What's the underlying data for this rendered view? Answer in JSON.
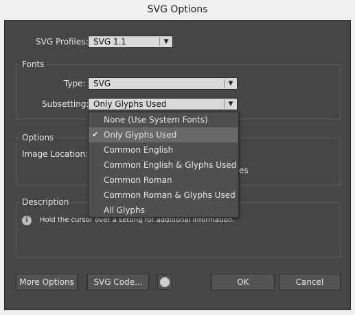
{
  "window": {
    "title": "SVG Options"
  },
  "profiles": {
    "label": "SVG Profiles:",
    "value": "SVG 1.1"
  },
  "fonts": {
    "group_title": "Fonts",
    "type_label": "Type:",
    "type_value": "SVG",
    "subsetting_label": "Subsetting:",
    "subsetting_value": "Only Glyphs Used"
  },
  "options": {
    "group_title": "Options",
    "image_location_label": "Image Location:",
    "partial_text": "es"
  },
  "subsetting_dropdown": {
    "items": [
      {
        "label": "None (Use System Fonts)"
      },
      {
        "label": "Only Glyphs Used",
        "selected": true
      },
      {
        "label": "Common English"
      },
      {
        "label": "Common English & Glyphs Used"
      },
      {
        "label": "Common Roman"
      },
      {
        "label": "Common Roman & Glyphs Used"
      },
      {
        "label": "All Glyphs"
      }
    ]
  },
  "description": {
    "group_title": "Description",
    "text": "Hold the cursor over a setting for additional information."
  },
  "buttons": {
    "more_options": "More Options",
    "svg_code": "SVG Code...",
    "ok": "OK",
    "cancel": "Cancel"
  },
  "icons": {
    "info": "info-icon",
    "globe": "globe-icon",
    "check": "checkmark-icon",
    "dropdown_arrow": "chevron-down-icon"
  },
  "colors": {
    "dialog_bg": "#464646",
    "control_bg": "#d9d9d9",
    "menu_highlight": "#686868"
  }
}
